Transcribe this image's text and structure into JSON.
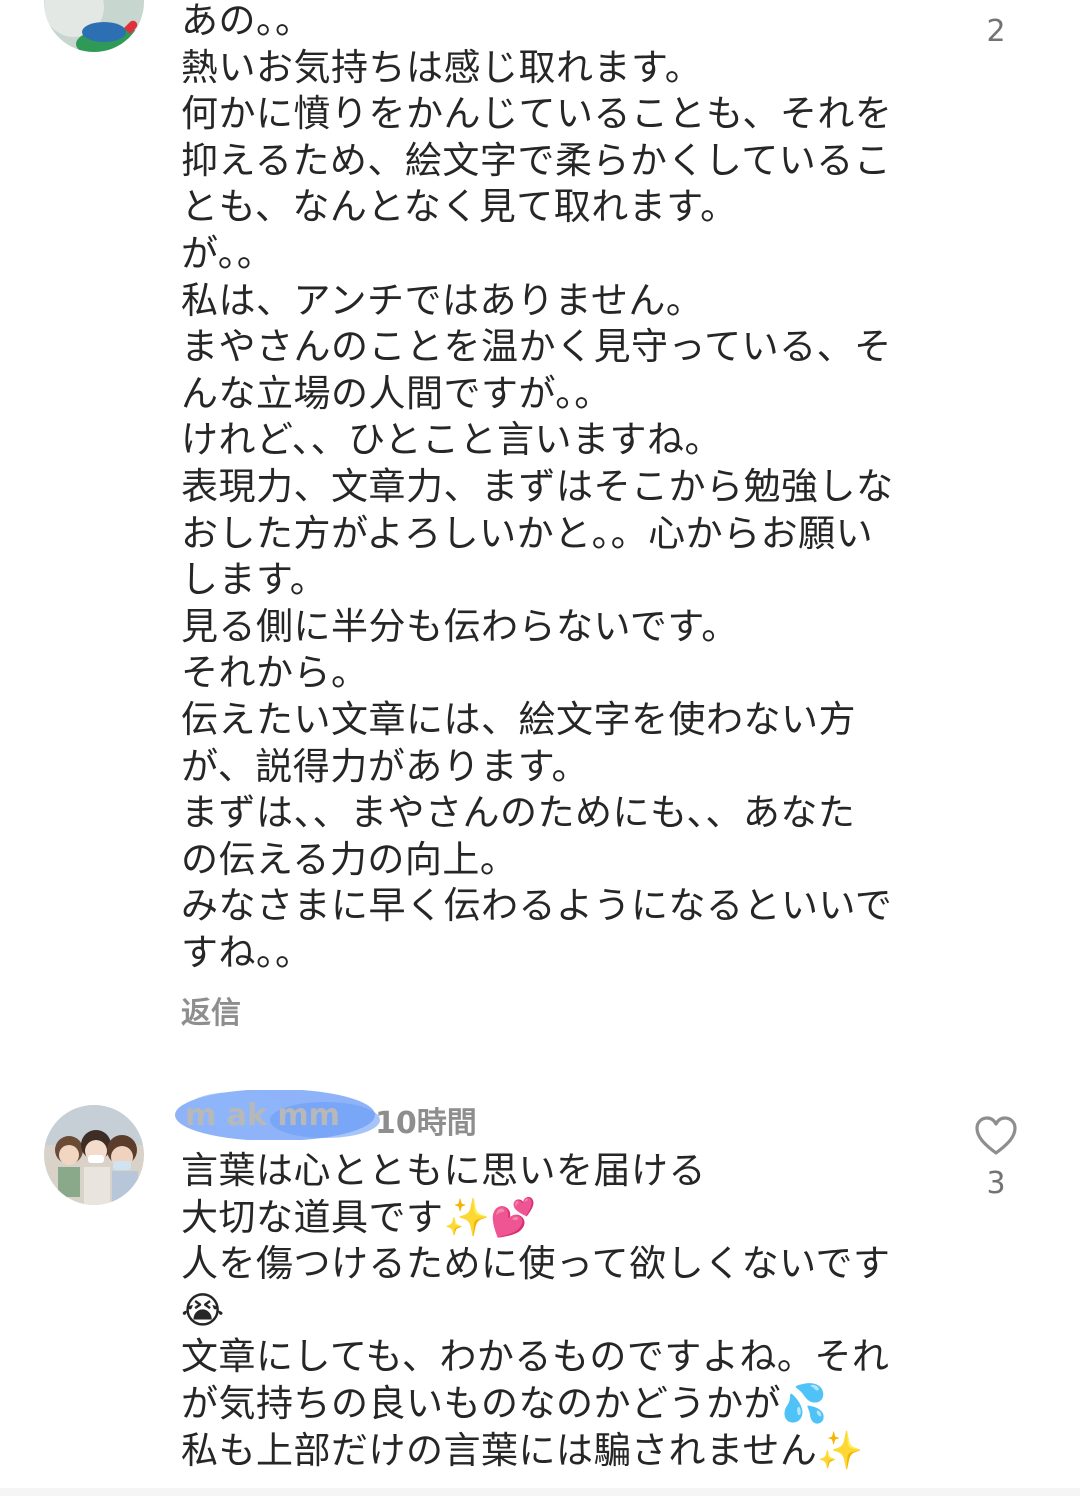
{
  "comment1": {
    "like_count": "2",
    "text": "あの。。\n熱いお気持ちは感じ取れます。\n何かに憤りをかんじていることも、それを\n抑えるため、絵文字で柔らかくしているこ\nとも、なんとなく見て取れます。\nが。。\n私は、アンチではありません。\nまやさんのことを温かく見守っている、そ\nんな立場の人間ですが。。\nけれど、、ひとこと言いますね。\n表現力、文章力、まずはそこから勉強しな\nおした方がよろしいかと。。心からお願い\nします。\n見る側に半分も伝わらないです。\nそれから。\n伝えたい文章には、絵文字を使わない方\nが、説得力があります。\nまずは、、まやさんのためにも、、あなた\nの伝える力の向上。\nみなさまに早く伝わるようになるといいで\nすね。。",
    "reply_label": "返信"
  },
  "comment2": {
    "username": "m  ak   mm",
    "timestamp": "10時間",
    "like_count": "3",
    "text": "言葉は心とともに思いを届ける\n大切な道具です✨💕\n人を傷つけるために使って欲しくないです\n😭\n文章にしても、わかるものですよね。それ\nが気持ちの良いものなのかどうかが💦\n私も上部だけの言葉には騙されません✨"
  },
  "colors": {
    "text": "#262626",
    "secondary": "#8e8e8e",
    "blur_accent": "#7aa6f7"
  },
  "icons": {
    "like": "heart-outline-icon",
    "avatar1": "avatar-photo",
    "avatar2": "avatar-group-photo"
  }
}
